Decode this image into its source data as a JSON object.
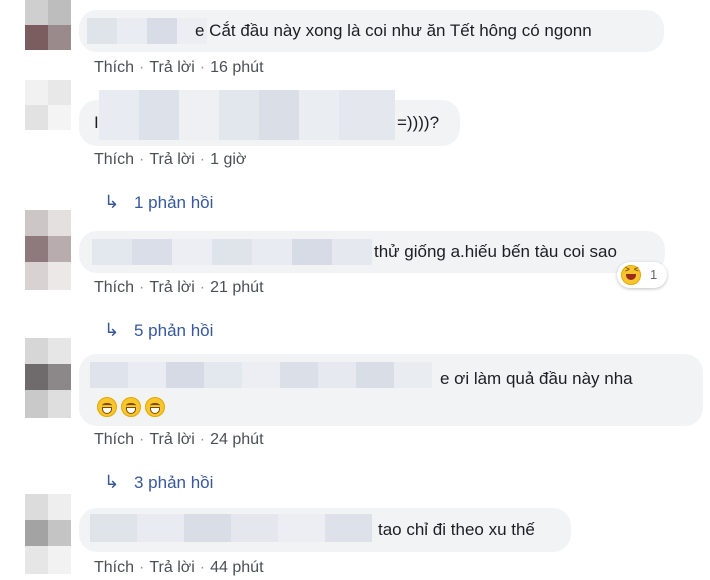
{
  "comments": [
    {
      "text": "e Cắt đầu này xong là coi như ăn Tết hông có ngonn",
      "actions": {
        "like": "Thích",
        "reply": "Trả lời",
        "sep": "·",
        "time": "16 phút"
      }
    },
    {
      "text_start": "I",
      "text": "=))))?",
      "actions": {
        "like": "Thích",
        "reply": "Trả lời",
        "sep": "·",
        "time": "1 giờ"
      },
      "replies_label": "1 phản hồi"
    },
    {
      "text": "thử giống a.hiếu bến tàu coi sao",
      "actions": {
        "like": "Thích",
        "reply": "Trả lời",
        "sep": "·",
        "time": "21 phút"
      },
      "reaction": {
        "icon": "laughing-emoji-icon",
        "count": "1"
      },
      "replies_label": "5 phản hồi"
    },
    {
      "text": "e ơi làm quả đầu này nha",
      "emoji_icons": [
        "grinning-emoji-icon",
        "grinning-emoji-icon",
        "grinning-emoji-icon"
      ],
      "actions": {
        "like": "Thích",
        "reply": "Trả lời",
        "sep": "·",
        "time": "24 phút"
      },
      "replies_label": "3 phản hồi"
    },
    {
      "text": "tao chỉ đi theo xu thế",
      "actions": {
        "like": "Thích",
        "reply": "Trả lời",
        "sep": "·",
        "time": "44 phút"
      }
    }
  ],
  "reply_arrow_icon": "reply-arrow-icon",
  "colors": {
    "bubble": "#f2f3f5",
    "link": "#385898",
    "meta": "#606770"
  }
}
